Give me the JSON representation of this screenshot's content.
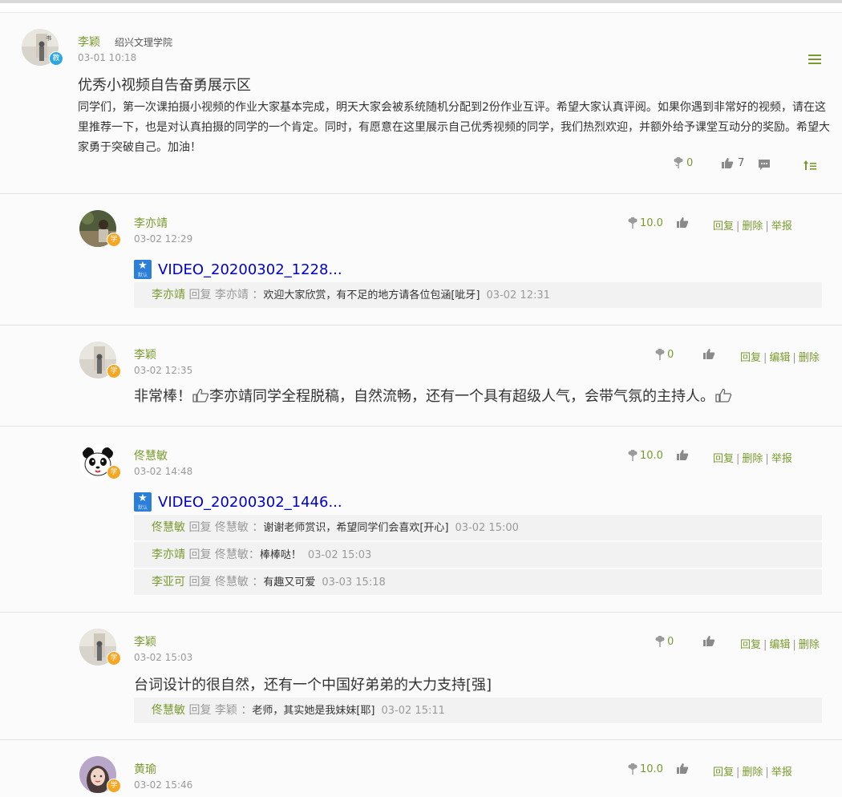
{
  "post": {
    "author": "李颖",
    "school": "绍兴文理学院",
    "time": "03-01 10:18",
    "role_badge": "教",
    "title": "优秀小视频自告奋勇展示区",
    "body": "同学们，第一次课拍摄小视频的作业大家基本完成，明天大家会被系统随机分配到2份作业互评。希望大家认真评阅。如果你遇到非常好的视频，请在这里推荐一下，也是对认真拍摄的同学的一个肯定。同时，有愿意在这里展示自己优秀视频的同学，我们热烈欢迎，并额外给予课堂互动分的奖励。希望大家勇于突破自己。加油！",
    "flowers": "0",
    "likes": "7"
  },
  "replies": [
    {
      "author": "李亦靖",
      "badge": "学",
      "time": "03-02 12:29",
      "score": "10.0",
      "actions": [
        "回复",
        "删除",
        "举报"
      ],
      "video": "VIDEO_20200302_1228...",
      "subreplies": [
        {
          "who": "李亦靖",
          "mid": " 回复 李亦靖 ：",
          "text": "欢迎大家欣赏，有不足的地方请各位包涵[呲牙]",
          "time": "03-02 12:31"
        }
      ]
    },
    {
      "author": "李颖",
      "badge": "学",
      "time": "03-02 12:35",
      "score": "0",
      "actions": [
        "回复",
        "编辑",
        "删除"
      ],
      "text_a": "非常棒！",
      "text_b": "李亦靖同学全程脱稿，自然流畅，还有一个具有超级人气，会带气氛的主持人。"
    },
    {
      "author": "佟慧敏",
      "badge": "学",
      "time": "03-02 14:48",
      "score": "10.0",
      "actions": [
        "回复",
        "删除",
        "举报"
      ],
      "video": "VIDEO_20200302_1446...",
      "subreplies": [
        {
          "who": "佟慧敏",
          "mid": " 回复 佟慧敏 ：",
          "text": "谢谢老师赏识，希望同学们会喜欢[开心]",
          "time": "03-02 15:00"
        },
        {
          "who": "李亦靖",
          "mid": " 回复 佟慧敏：",
          "text": "棒棒哒！",
          "time": "03-02 15:03"
        },
        {
          "who": "李亚可",
          "mid": " 回复 佟慧敏 ：",
          "text": "有趣又可爱",
          "time": "03-03 15:18"
        }
      ]
    },
    {
      "author": "李颖",
      "badge": "学",
      "time": "03-02 15:03",
      "score": "0",
      "actions": [
        "回复",
        "编辑",
        "删除"
      ],
      "text": "台词设计的很自然，还有一个中国好弟弟的大力支持[强]",
      "subreplies": [
        {
          "who": "佟慧敏",
          "mid": " 回复 李颖 ：",
          "text": "老师，其实她是我妹妹[耶]",
          "time": "03-02 15:11"
        }
      ]
    },
    {
      "author": "黄瑜",
      "badge": "学",
      "time": "03-02 15:46",
      "score": "10.0",
      "actions": [
        "回复",
        "删除",
        "举报"
      ]
    }
  ]
}
